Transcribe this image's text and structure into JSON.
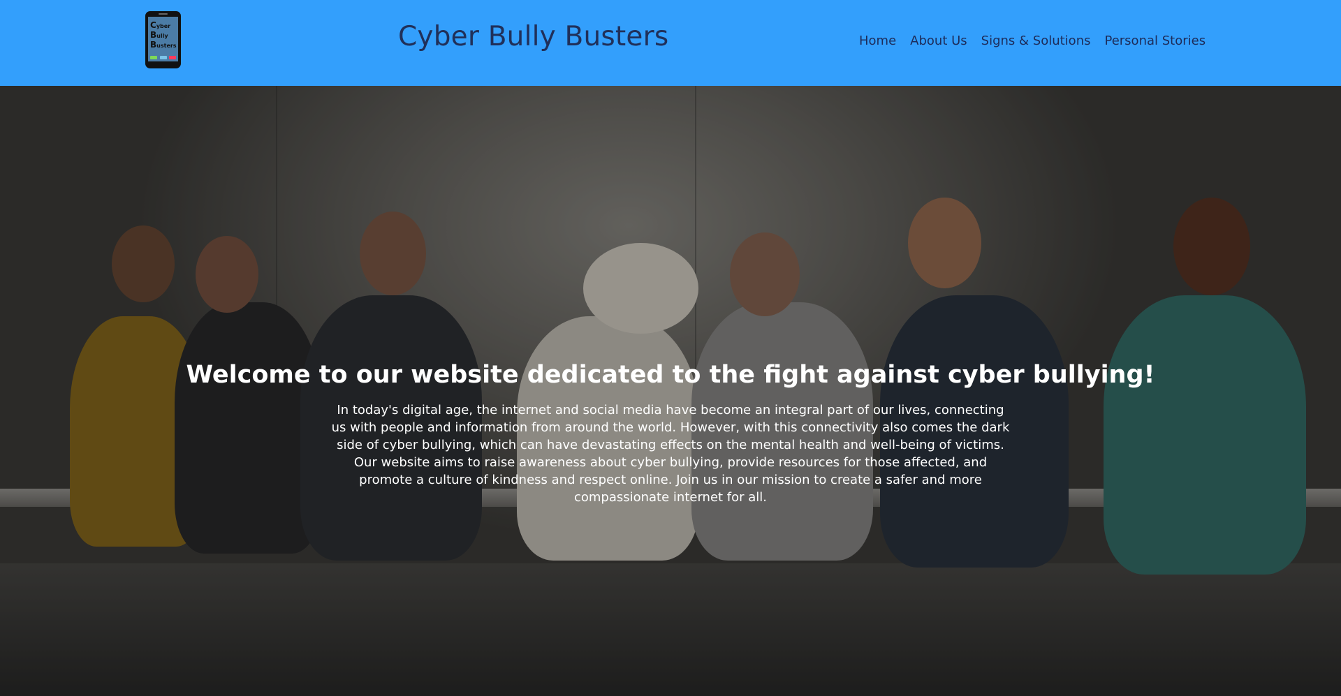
{
  "logo": {
    "lines": [
      {
        "initial": "C",
        "rest": "yber"
      },
      {
        "initial": "B",
        "rest": "ully"
      },
      {
        "initial": "B",
        "rest": "usters"
      }
    ],
    "button_colors": [
      "#7ed957",
      "#7cc4e8",
      "#ff3b5c"
    ]
  },
  "header": {
    "title": "Cyber Bully Busters",
    "background": "#339ffc"
  },
  "nav": {
    "items": [
      {
        "label": "Home"
      },
      {
        "label": "About Us"
      },
      {
        "label": "Signs & Solutions"
      },
      {
        "label": "Personal Stories"
      }
    ]
  },
  "hero": {
    "title": "Welcome to our website dedicated to the fight against cyber bullying!",
    "body": "In today's digital age, the internet and social media have become an integral part of our lives, connecting us with people and information from around the world. However, with this connectivity also comes the dark side of cyber bullying, which can have devastating effects on the mental health and well-being of victims. Our website aims to raise awareness about cyber bullying, provide resources for those affected, and promote a culture of kindness and respect online. Join us in our mission to create a safer and more compassionate internet for all."
  }
}
